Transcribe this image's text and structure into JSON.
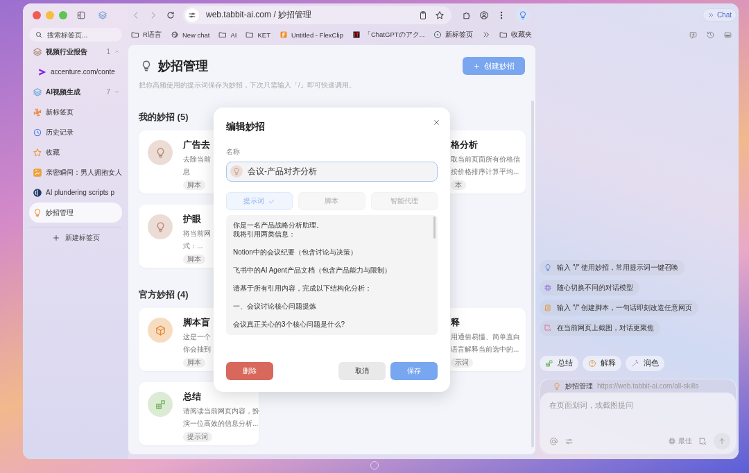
{
  "sidebar": {
    "search": {
      "placeholder": "搜索标签页..."
    },
    "items": [
      {
        "label": "视频行业报告",
        "kind": "group",
        "count": "1",
        "expanded": true,
        "selected": false,
        "children": [
          {
            "label": "accenture.com/conte",
            "selected": false
          }
        ]
      },
      {
        "label": "AI视频生成",
        "kind": "group",
        "count": "7",
        "expanded": false,
        "selected": false
      },
      {
        "label": "新标签页",
        "kind": "tab",
        "selected": false
      },
      {
        "label": "历史记录",
        "kind": "tab",
        "selected": false
      },
      {
        "label": "收藏",
        "kind": "tab",
        "selected": false
      },
      {
        "label": "亲密瞬间：男人拥抱女人",
        "kind": "tab",
        "selected": false
      },
      {
        "label": "AI plundering scripts p",
        "kind": "tab",
        "selected": false
      },
      {
        "label": "妙招管理",
        "kind": "tab",
        "selected": true
      }
    ],
    "new_tab": "新建标签页"
  },
  "toolbar": {
    "url": "web.tabbit-ai.com / 妙招管理"
  },
  "bookmarks": [
    "R语言",
    "New chat",
    "AI",
    "KET",
    "Untitled - FlexClip",
    "「ChatGPTのアク...",
    "新标签页"
  ],
  "bookmark_folder": "收藏夹",
  "page": {
    "title": "妙招管理",
    "subtitle": "把你高频使用的提示词保存为妙招，下次只需输入「/」即可快速调用。",
    "create_button": "创建妙招",
    "sections": [
      {
        "heading": "我的妙招 (5)",
        "rows": [
          [
            {
              "title": "广告去",
              "lines": [
                "去除当前",
                "息"
              ],
              "tag": "脚本"
            },
            {
              "title": "格分析",
              "lines": [
                "取当前页面所有价格信",
                "按价格排序计算平均..."
              ],
              "tag": "本"
            }
          ],
          [
            {
              "title": "护眼",
              "lines": [
                "将当前网",
                "式：..."
              ],
              "tag": "脚本"
            }
          ]
        ]
      },
      {
        "heading": "官方妙招 (4)",
        "rows": [
          [
            {
              "title": "脚本盲",
              "lines": [
                "这是一个",
                "你会抽到"
              ],
              "tag": "脚本"
            },
            {
              "title": "释",
              "lines": [
                "用通俗易懂、简单直白",
                "语言解释当前选中的..."
              ],
              "tag": "示词"
            }
          ],
          [
            {
              "title": "总结",
              "lines": [
                "请阅读当前网页内容，扮",
                "演一位高效的信息分析..."
              ],
              "tag": "提示词"
            }
          ]
        ]
      }
    ]
  },
  "dialog": {
    "title": "编辑妙招",
    "name_label": "名称",
    "name_value": "会议-产品对齐分析",
    "tabs": [
      {
        "label": "提示词",
        "selected": true
      },
      {
        "label": "脚本",
        "selected": false
      },
      {
        "label": "智能代理",
        "selected": false
      }
    ],
    "prompt": [
      "你是一名产品战略分析助理。",
      "我将引用两类信息：",
      "Notion中的会议纪要（包含讨论与决策）",
      "飞书中的AI Agent产品文档（包含产品能力与限制）",
      "请基于所有引用内容，完成以下结构化分析：",
      "一、会议讨论核心问题提炼",
      "会议真正关心的3个核心问题是什么?"
    ],
    "delete_button": "删除",
    "cancel_button": "取消",
    "save_button": "保存"
  },
  "chat": {
    "button": "Chat",
    "suggestions": [
      "输入 \"/\" 使用妙招，常用提示词一键召唤",
      "随心切换不同的对话模型",
      "输入 \"/\" 创建脚本，一句话即刻改造任意网页",
      "在当前网页上截图，对话更聚焦"
    ],
    "actions": [
      "总结",
      "解释",
      "润色"
    ],
    "context": {
      "title": "妙招管理",
      "url": "https://web.tabbit-ai.com/all-skills"
    },
    "input": {
      "placeholder": "在页面划词，或截图提问"
    },
    "model": "最佳"
  }
}
